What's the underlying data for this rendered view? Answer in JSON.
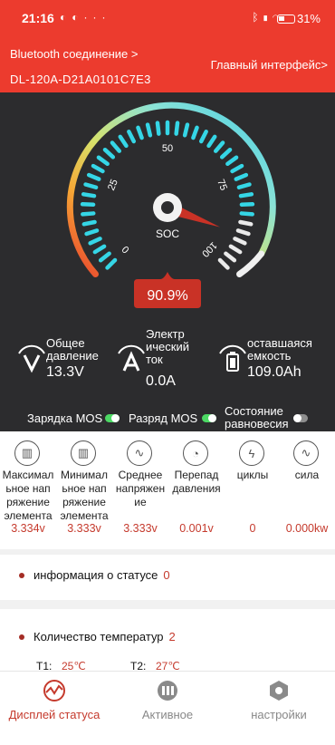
{
  "status_bar": {
    "time": "21:16",
    "notification_icons": [
      "chat-icon",
      "chat-icon",
      "dots-icon"
    ],
    "system_icons": [
      "bluetooth-icon",
      "signal-icon",
      "wifi-icon"
    ],
    "battery_percent": "31%"
  },
  "header": {
    "bluetooth_link": "Bluetooth соединение >",
    "main_interface_link": "Главный интерфейс>",
    "device_id": "DL-120A-D21A0101C7E3"
  },
  "gauge": {
    "ticks": [
      "0",
      "25",
      "50",
      "75",
      "100"
    ],
    "center_label": "SOC",
    "soc_value": "90.9%",
    "soc_percent": 90.9
  },
  "metrics": {
    "voltage": {
      "label_lines": [
        "Общее",
        "давление"
      ],
      "value": "13.3V"
    },
    "current": {
      "label_lines": [
        "Электр",
        "ический",
        "ток"
      ],
      "value": "0.0A"
    },
    "capacity": {
      "label_lines": [
        "оставшаяся",
        "емкость"
      ],
      "value": "109.0Ah"
    }
  },
  "toggles": {
    "charge_mos": {
      "label": "Зарядка MOS",
      "on": true
    },
    "discharge_mos": {
      "label": "Разряд MOS",
      "on": true
    },
    "balance": {
      "label_lines": [
        "Состояние",
        "равновесия"
      ],
      "on": false
    }
  },
  "cells": [
    {
      "icon": "cell-max-icon",
      "label_lines": [
        "Максимал",
        "ьное нап",
        "ряжение",
        "элемента"
      ],
      "value": "3.334v"
    },
    {
      "icon": "cell-min-icon",
      "label_lines": [
        "Минимал",
        "ьное нап",
        "ряжение",
        "элемента"
      ],
      "value": "3.333v"
    },
    {
      "icon": "sine-wave-icon",
      "label_lines": [
        "Среднее",
        "напряжен",
        "ие"
      ],
      "value": "3.333v"
    },
    {
      "icon": "gauge-icon",
      "label_lines": [
        "Перепад",
        "давления"
      ],
      "value": "0.001v"
    },
    {
      "icon": "lightning-icon",
      "label_lines": [
        "циклы"
      ],
      "value": "0"
    },
    {
      "icon": "power-wave-icon",
      "label_lines": [
        "сила"
      ],
      "value": "0.000kw"
    }
  ],
  "status_info": {
    "label": "информация о статусе",
    "value": "0"
  },
  "temperature": {
    "label": "Количество температур",
    "count": "2",
    "t1_label": "T1:",
    "t1_value": "25℃",
    "t2_label": "T2:",
    "t2_value": "27℃"
  },
  "nav": {
    "status_display": "Дисплей статуса",
    "active": "Активное",
    "settings": "настройки"
  },
  "colors": {
    "accent": "#ec3b2e",
    "value_red": "#c53a2d",
    "dark_bg": "#2c2c2e",
    "gauge_cyan": "#35d6e6",
    "toggle_green": "#4cd964"
  }
}
